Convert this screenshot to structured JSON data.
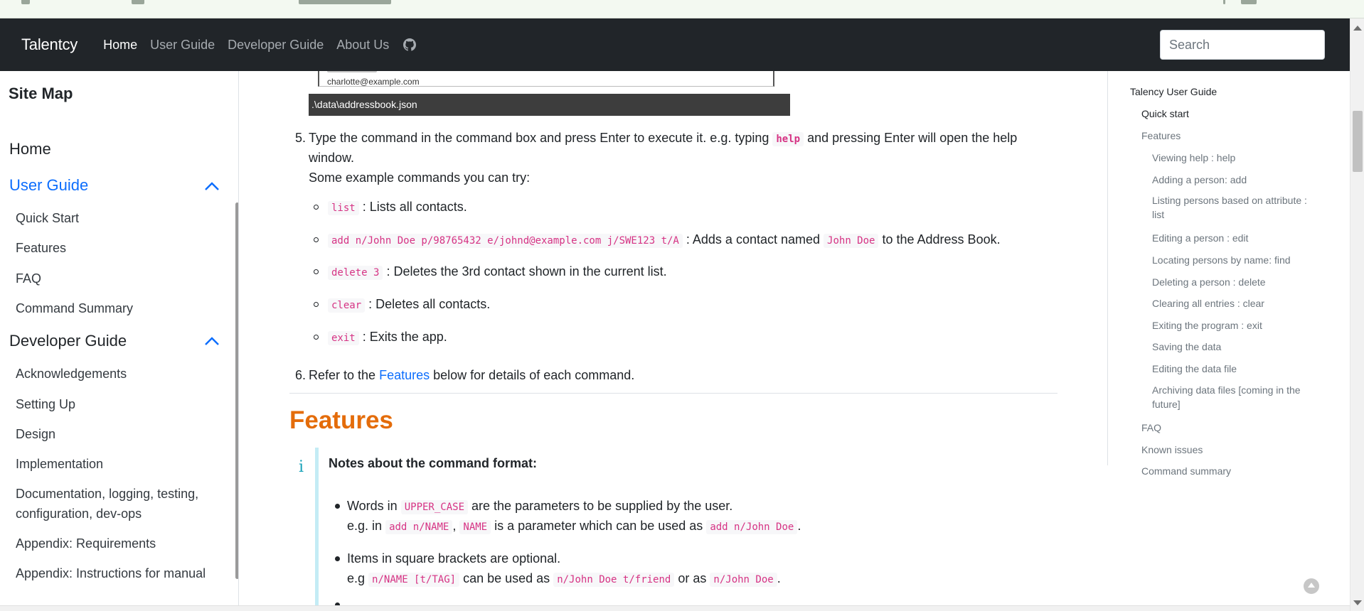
{
  "navbar": {
    "brand": "Talentcy",
    "links": [
      "Home",
      "User Guide",
      "Developer Guide",
      "About Us"
    ],
    "search_placeholder": "Search"
  },
  "sidebar": {
    "title": "Site Map",
    "home": "Home",
    "user_guide": {
      "label": "User Guide",
      "items": [
        "Quick Start",
        "Features",
        "FAQ",
        "Command Summary"
      ]
    },
    "developer_guide": {
      "label": "Developer Guide",
      "items": [
        "Acknowledgements",
        "Setting Up",
        "Design",
        "Implementation",
        "Documentation, logging, testing, configuration, dev-ops",
        "Appendix: Requirements",
        "Appendix: Instructions for manual"
      ]
    }
  },
  "main": {
    "screenshot_email": "charlotte@example.com",
    "screenshot_path": ".\\data\\addressbook.json",
    "step5": {
      "num": "5.",
      "text_a": "Type the command in the command box and press Enter to execute it. e.g. typing",
      "code": "help",
      "text_b": "and pressing Enter will open the help",
      "text_c": "window.",
      "text_d": "Some example commands you can try:"
    },
    "examples": [
      {
        "code": "list",
        "text": ": Lists all contacts."
      },
      {
        "code": "add n/John Doe p/98765432 e/johnd@example.com j/SWE123 t/A",
        "text": ": Adds a contact named",
        "code2": "John Doe",
        "text2": "to the Address Book."
      },
      {
        "code": "delete 3",
        "text": ": Deletes the 3rd contact shown in the current list."
      },
      {
        "code": "clear",
        "text": ": Deletes all contacts."
      },
      {
        "code": "exit",
        "text": ": Exits the app."
      }
    ],
    "step6": {
      "num": "6.",
      "text_a": "Refer to the",
      "link": "Features",
      "text_b": "below for details of each command."
    },
    "features_heading": "Features",
    "note": {
      "title": "Notes about the command format:",
      "b1": {
        "t1": "Words in",
        "c1": "UPPER_CASE",
        "t2": "are the parameters to be supplied by the user.",
        "t3": "e.g. in",
        "c2": "add n/NAME",
        "t4": ",",
        "c3": "NAME",
        "t5": "is a parameter which can be used as",
        "c4": "add n/John Doe",
        "t6": "."
      },
      "b2": {
        "t1": "Items in square brackets are optional.",
        "t2": "e.g",
        "c1": "n/NAME [t/TAG]",
        "t3": "can be used as",
        "c2": "n/John Doe t/friend",
        "t4": "or as",
        "c3": "n/John Doe",
        "t5": "."
      }
    }
  },
  "toc": {
    "title": "Talency User Guide",
    "items": [
      {
        "label": "Quick start",
        "level": 1
      },
      {
        "label": "Features",
        "level": 1
      },
      {
        "label": "Viewing help : help",
        "level": 2
      },
      {
        "label": "Adding a person: add",
        "level": 2
      },
      {
        "label": "Listing persons based on attribute : list",
        "level": 2
      },
      {
        "label": "Editing a person : edit",
        "level": 2
      },
      {
        "label": "Locating persons by name: find",
        "level": 2
      },
      {
        "label": "Deleting a person : delete",
        "level": 2
      },
      {
        "label": "Clearing all entries : clear",
        "level": 2
      },
      {
        "label": "Exiting the program : exit",
        "level": 2
      },
      {
        "label": "Saving the data",
        "level": 2
      },
      {
        "label": "Editing the data file",
        "level": 2
      },
      {
        "label": "Archiving data files [coming in the future]",
        "level": 2
      },
      {
        "label": "FAQ",
        "level": 1
      },
      {
        "label": "Known issues",
        "level": 1
      },
      {
        "label": "Command summary",
        "level": 1
      }
    ]
  },
  "colors": {
    "navbar": "#212529",
    "accent": "#0d6efd",
    "heading": "#e46c0a",
    "code": "#d63384"
  }
}
